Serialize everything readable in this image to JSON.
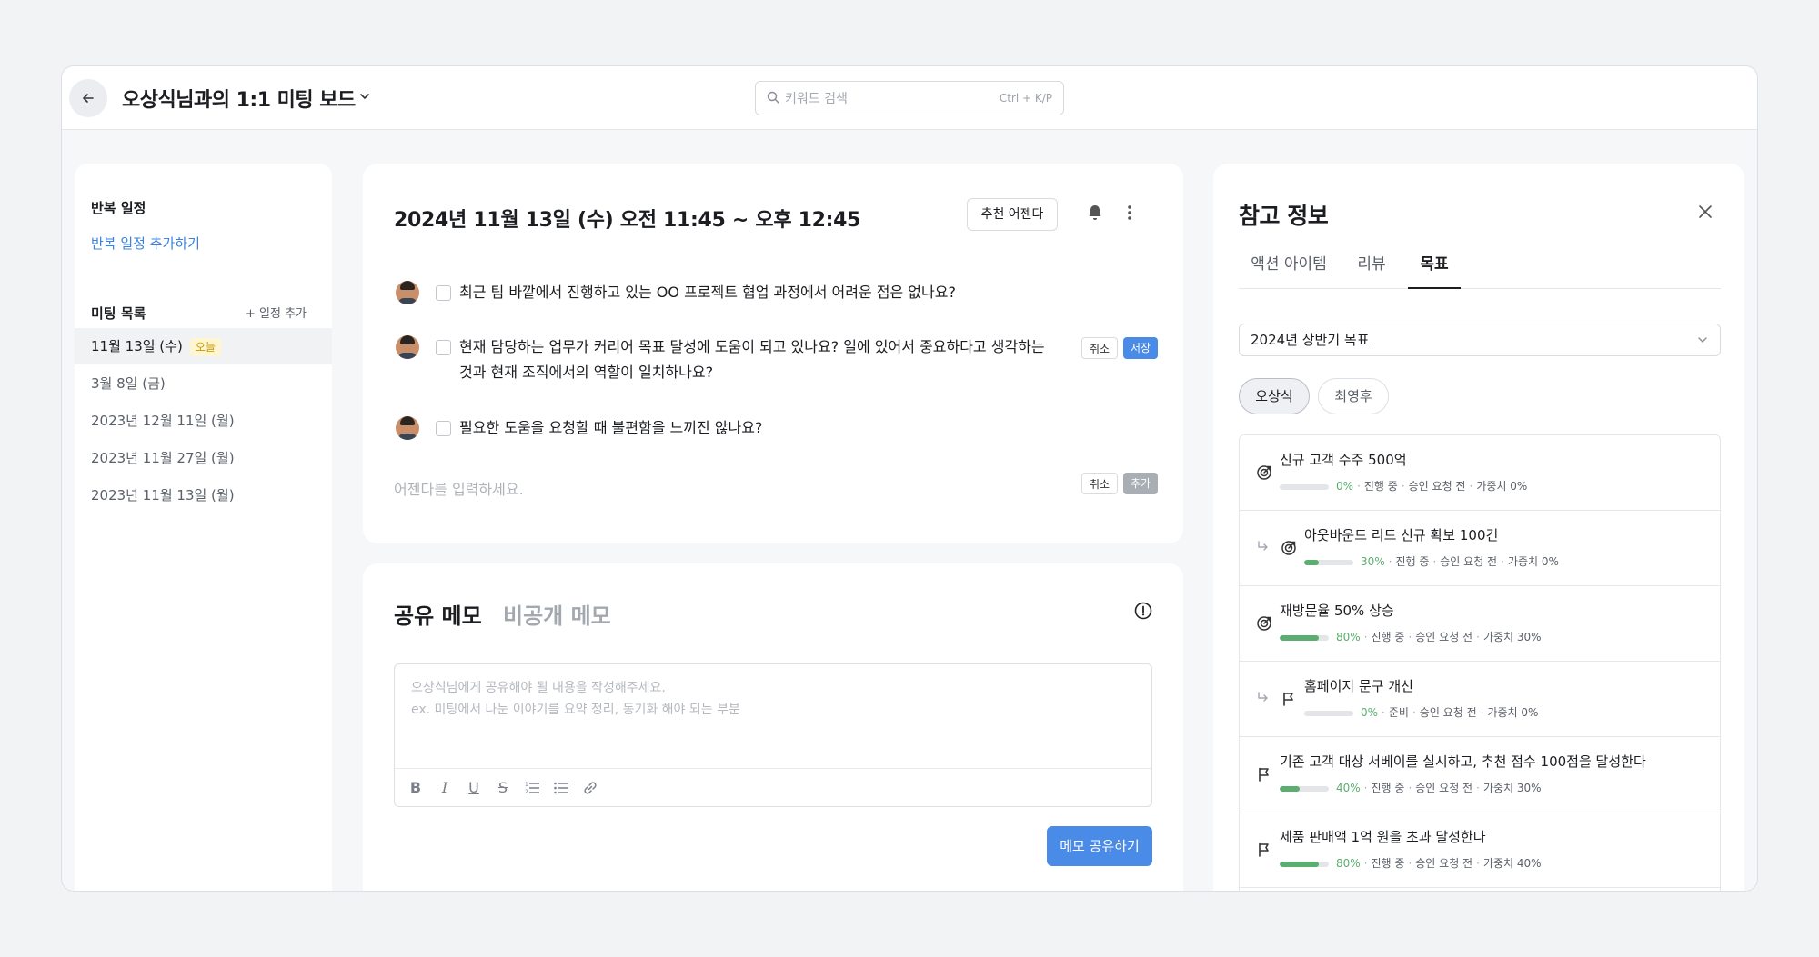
{
  "header": {
    "title": "오상식님과의 1:1 미팅 보드",
    "search_placeholder": "키워드 검색",
    "search_shortcut": "Ctrl + K/P"
  },
  "sidebar": {
    "recurring_title": "반복 일정",
    "add_recurring": "반복 일정 추가하기",
    "meetings_title": "미팅 목록",
    "add_schedule": "+ 일정 추가",
    "today_badge": "오늘",
    "meetings": [
      "11월 13일 (수)",
      "3월 8일 (금)",
      "2023년 12월 11일 (월)",
      "2023년 11월 27일 (월)",
      "2023년 11월 13일 (월)"
    ]
  },
  "agenda": {
    "time": "2024년 11월 13일 (수) 오전 11:45 ~ 오후 12:45",
    "recommend_button": "추천 어젠다",
    "questions": [
      "최근 팀 바깥에서 진행하고 있는 OO 프로젝트 협업 과정에서 어려운 점은 없나요?",
      "현재 담당하는 업무가 커리어 목표 달성에 도움이 되고 있나요? 일에 있어서 중요하다고 생각하는",
      "것과 현재 조직에서의 역할이 일치하나요?",
      "필요한 도움을 요청할 때 불편함을 느끼진 않나요?"
    ],
    "cancel_label": "취소",
    "save_label": "저장",
    "add_label": "추가",
    "input_placeholder": "어젠다를 입력하세요."
  },
  "memo": {
    "tab_shared": "공유 메모",
    "tab_private": "비공개 메모",
    "placeholder_line1": "오상식님에게 공유해야 될 내용을 작성해주세요.",
    "placeholder_line2": "ex. 미팅에서 나눈 이야기를 요약 정리, 동기화 해야 되는 부분",
    "share_button": "메모 공유하기"
  },
  "reference": {
    "title": "참고 정보",
    "tabs": [
      "액션 아이템",
      "리뷰",
      "목표"
    ],
    "selected_goal_set": "2024년 상반기 목표",
    "people": [
      "오상식",
      "최영후"
    ],
    "goals": [
      {
        "title": "신규 고객 수주 500억",
        "progress": "0%",
        "progress_value": 0,
        "status": "진행 중",
        "approval": "승인 요청 전",
        "weight": "가중치 0%",
        "icon": "target-icon",
        "sub": false
      },
      {
        "title": "아웃바운드 리드 신규 확보 100건",
        "progress": "30%",
        "progress_value": 30,
        "status": "진행 중",
        "approval": "승인 요청 전",
        "weight": "가중치 0%",
        "icon": "target-icon",
        "sub": true
      },
      {
        "title": "재방문율 50% 상승",
        "progress": "80%",
        "progress_value": 80,
        "status": "진행 중",
        "approval": "승인 요청 전",
        "weight": "가중치 30%",
        "icon": "target-icon",
        "sub": false
      },
      {
        "title": "홈페이지 문구 개선",
        "progress": "0%",
        "progress_value": 0,
        "status": "준비",
        "approval": "승인 요청 전",
        "weight": "가중치 0%",
        "icon": "flag-icon",
        "sub": true
      },
      {
        "title": "기존 고객 대상 서베이를 실시하고, 추천 점수 100점을 달성한다",
        "progress": "40%",
        "progress_value": 40,
        "status": "진행 중",
        "approval": "승인 요청 전",
        "weight": "가중치 30%",
        "icon": "flag-icon",
        "sub": false
      },
      {
        "title": "제품 판매액 1억 원을 초과 달성한다",
        "progress": "80%",
        "progress_value": 80,
        "status": "진행 중",
        "approval": "승인 요청 전",
        "weight": "가중치 40%",
        "icon": "flag-icon",
        "sub": false
      }
    ]
  },
  "colors": {
    "accent": "#4a8be8",
    "progress": "#5aae6f",
    "today_badge_bg": "#fff5d1"
  }
}
